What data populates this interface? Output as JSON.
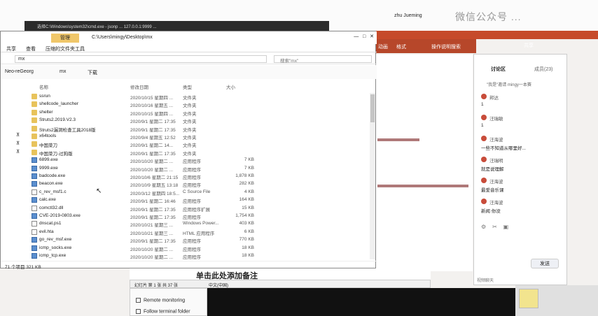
{
  "cmd": {
    "title": "选择C:\\Windows\\system32\\cmd.exe - jsonp ... 127.0.0.1:9999 ..."
  },
  "ppt": {
    "username": "zhu Jueming",
    "share": "共享",
    "tabs": [
      "动画",
      "格式",
      "操作说明搜索"
    ],
    "watermark": "微信公众号 ..."
  },
  "explorer": {
    "manage_tab": "管理",
    "path_title": "C:\\Users\\mingy\\Desktop\\mx",
    "ribbon": [
      "共享",
      "查看",
      "压缩的文件夹工具"
    ],
    "address": "mx",
    "search_placeholder": "搜索\"mx\"",
    "quick_access": [
      "Neo-reGeorg",
      "mx",
      "下载"
    ],
    "headers": {
      "name": "名称",
      "date": "修改日期",
      "type": "类型",
      "size": "大小"
    },
    "files": [
      {
        "name": "ssrun",
        "date": "2020/10/15 星期四 ...",
        "type": "文件夹",
        "size": "",
        "icon": "folder"
      },
      {
        "name": "shellcode_launcher",
        "date": "2020/10/16 星期五 ...",
        "type": "文件夹",
        "size": "",
        "icon": "folder"
      },
      {
        "name": "shelter",
        "date": "2020/10/15 星期四 ...",
        "type": "文件夹",
        "size": "",
        "icon": "folder"
      },
      {
        "name": "Struts2.2019.V2.3",
        "date": "2020/9/1 星期二 17:35",
        "type": "文件夹",
        "size": "",
        "icon": "folder"
      },
      {
        "name": "Struts2漏洞检查工具2018版",
        "date": "2020/9/1 星期二 17:35",
        "type": "文件夹",
        "size": "",
        "icon": "folder"
      },
      {
        "name": "x64tools",
        "date": "2020/9/4 星期五 12:52",
        "type": "文件夹",
        "size": "",
        "icon": "folder"
      },
      {
        "name": "中国菜刀",
        "date": "2020/9/1 星期二 14...",
        "type": "文件夹",
        "size": "",
        "icon": "folder"
      },
      {
        "name": "中国菜刀-过狗版",
        "date": "2020/9/1 星期二 17:35",
        "type": "文件夹",
        "size": "",
        "icon": "folder"
      },
      {
        "name": "6899.exe",
        "date": "2020/10/20 星期二 ...",
        "type": "应用程序",
        "size": "7 KB",
        "icon": "exe"
      },
      {
        "name": "9999.exe",
        "date": "2020/10/20 星期二 ...",
        "type": "应用程序",
        "size": "7 KB",
        "icon": "exe"
      },
      {
        "name": "badcode.exe",
        "date": "2020/10/6 星期二 21:15",
        "type": "应用程序",
        "size": "1,878 KB",
        "icon": "exe"
      },
      {
        "name": "beacon.exe",
        "date": "2020/10/9 星期五 13:18",
        "type": "应用程序",
        "size": "282 KB",
        "icon": "exe"
      },
      {
        "name": "c_rev_msf1.c",
        "date": "2020/3/12 星期四 18:5...",
        "type": "C Source File",
        "size": "4 KB",
        "icon": "file"
      },
      {
        "name": "calc.exe",
        "date": "2020/9/1 星期二 16:46",
        "type": "应用程序",
        "size": "164 KB",
        "icon": "exe"
      },
      {
        "name": "comctl32.dll",
        "date": "2020/9/1 星期二 17:35",
        "type": "应用程序扩展",
        "size": "15 KB",
        "icon": "file"
      },
      {
        "name": "CVE-2019-0803.exe",
        "date": "2020/9/1 星期二 17:35",
        "type": "应用程序",
        "size": "1,754 KB",
        "icon": "exe"
      },
      {
        "name": "dnscat.ps1",
        "date": "2020/10/21 星期三 ...",
        "type": "Windows Power...",
        "size": "403 KB",
        "icon": "file"
      },
      {
        "name": "evil.hta",
        "date": "2020/10/21 星期三 ...",
        "type": "HTML 应用程序",
        "size": "6 KB",
        "icon": "file"
      },
      {
        "name": "go_rev_msf.exe",
        "date": "2020/9/1 星期二 17:35",
        "type": "应用程序",
        "size": "770 KB",
        "icon": "exe"
      },
      {
        "name": "icmp_socks.exe",
        "date": "2020/10/20 星期二 ...",
        "type": "应用程序",
        "size": "18 KB",
        "icon": "exe"
      },
      {
        "name": "icmp_tcp.exe",
        "date": "2020/10/20 星期二 ...",
        "type": "应用程序",
        "size": "18 KB",
        "icon": "exe"
      }
    ],
    "status": "71 个项目   321 KB"
  },
  "chat": {
    "tab_discuss": "讨论区",
    "tab_members": "成员(23)",
    "notice": "\"我是\"邀请 mingy一本赛",
    "messages": [
      {
        "name": "邦达",
        "text": "1"
      },
      {
        "name": "汪瑞敏",
        "text": "1"
      },
      {
        "name": "汪海波",
        "text": "一些不知道从哪里好..."
      },
      {
        "name": "汪瑞明",
        "text": "就是说理解"
      },
      {
        "name": "汪海波",
        "text": "最爱音乐课"
      },
      {
        "name": "汪海波",
        "text": "新闻 你没"
      }
    ],
    "send": "发送",
    "bottom_label": "视频聊天"
  },
  "notes": {
    "placeholder": "单击此处添加备注"
  },
  "remote": {
    "remote_monitoring": "Remote monitoring",
    "follow_terminal": "Follow terminal folder"
  },
  "bottom_toolbar": [
    "幻灯片 第 1 张 共 37 张",
    "中文(中国)"
  ]
}
